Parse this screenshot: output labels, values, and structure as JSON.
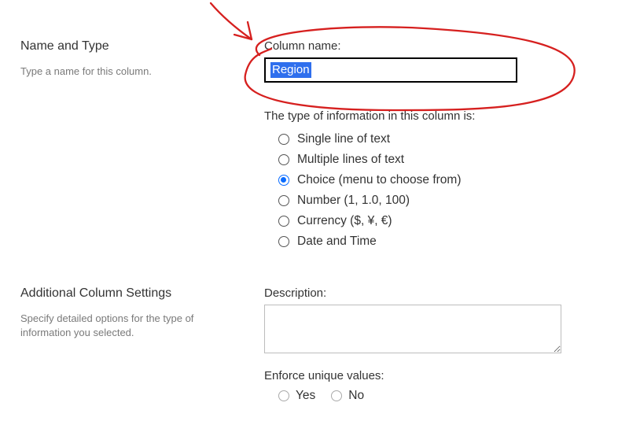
{
  "sections": {
    "nameType": {
      "heading": "Name and Type",
      "sub": "Type a name for this column.",
      "columnNameLabel": "Column name:",
      "columnNameValue": "Region",
      "typeInfoLabel": "The type of information in this column is:",
      "typeOptions": [
        {
          "label": "Single line of text",
          "checked": false
        },
        {
          "label": "Multiple lines of text",
          "checked": false
        },
        {
          "label": "Choice (menu to choose from)",
          "checked": true
        },
        {
          "label": "Number (1, 1.0, 100)",
          "checked": false
        },
        {
          "label": "Currency ($, ¥, €)",
          "checked": false
        },
        {
          "label": "Date and Time",
          "checked": false
        }
      ]
    },
    "additional": {
      "heading": "Additional Column Settings",
      "sub": "Specify detailed options for the type of information you selected.",
      "descriptionLabel": "Description:",
      "descriptionValue": "",
      "enforceLabel": "Enforce unique values:",
      "enforceOptions": [
        {
          "label": "Yes",
          "checked": false
        },
        {
          "label": "No",
          "checked": false
        }
      ]
    }
  }
}
